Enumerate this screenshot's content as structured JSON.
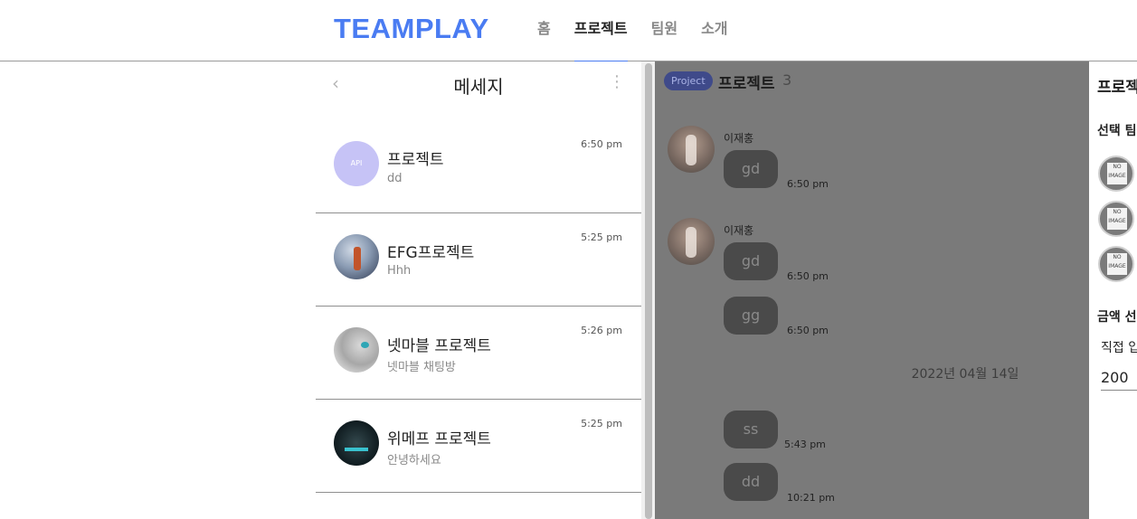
{
  "header": {
    "logo": "TEAMPLAY",
    "nav": [
      "홈",
      "프로젝트",
      "팀원",
      "소개"
    ],
    "active_nav": "프로젝트",
    "accent_color": "#4a7cf2"
  },
  "messages_panel": {
    "title": "메세지",
    "back_icon": "chevron-left-icon",
    "more_icon": "more-vertical-icon",
    "rooms": [
      {
        "name": "프로젝트",
        "last": "dd",
        "time": "6:50 pm",
        "avatar_text": "API"
      },
      {
        "name": "EFG프로젝트",
        "last": "Hhh",
        "time": "5:25 pm"
      },
      {
        "name": "넷마블 프로젝트",
        "last": "넷마블 채팅방",
        "time": "5:26 pm"
      },
      {
        "name": "위메프 프로젝트",
        "last": "안녕하세요",
        "time": "5:25 pm"
      }
    ]
  },
  "chat": {
    "badge": "Project",
    "title": "프로젝트",
    "count": "3",
    "messages": [
      {
        "sender": "이재홍",
        "text": "gd",
        "time": "6:50 pm"
      },
      {
        "sender": "이재홍",
        "text": "gd",
        "time": "6:50 pm"
      },
      {
        "text": "gg",
        "time": "6:50 pm"
      }
    ],
    "date_separator": "2022년 04월 14일",
    "later_messages": [
      {
        "text": "ss",
        "time": "5:43 pm"
      },
      {
        "text": "dd",
        "time": "10:21 pm"
      }
    ]
  },
  "right_panel": {
    "title": "프로젝트",
    "select_team": "선택 팀원",
    "member_badge": "NO IMAGE",
    "amount": "금액 선택",
    "direct": "직접 입력",
    "input_value": "200"
  }
}
